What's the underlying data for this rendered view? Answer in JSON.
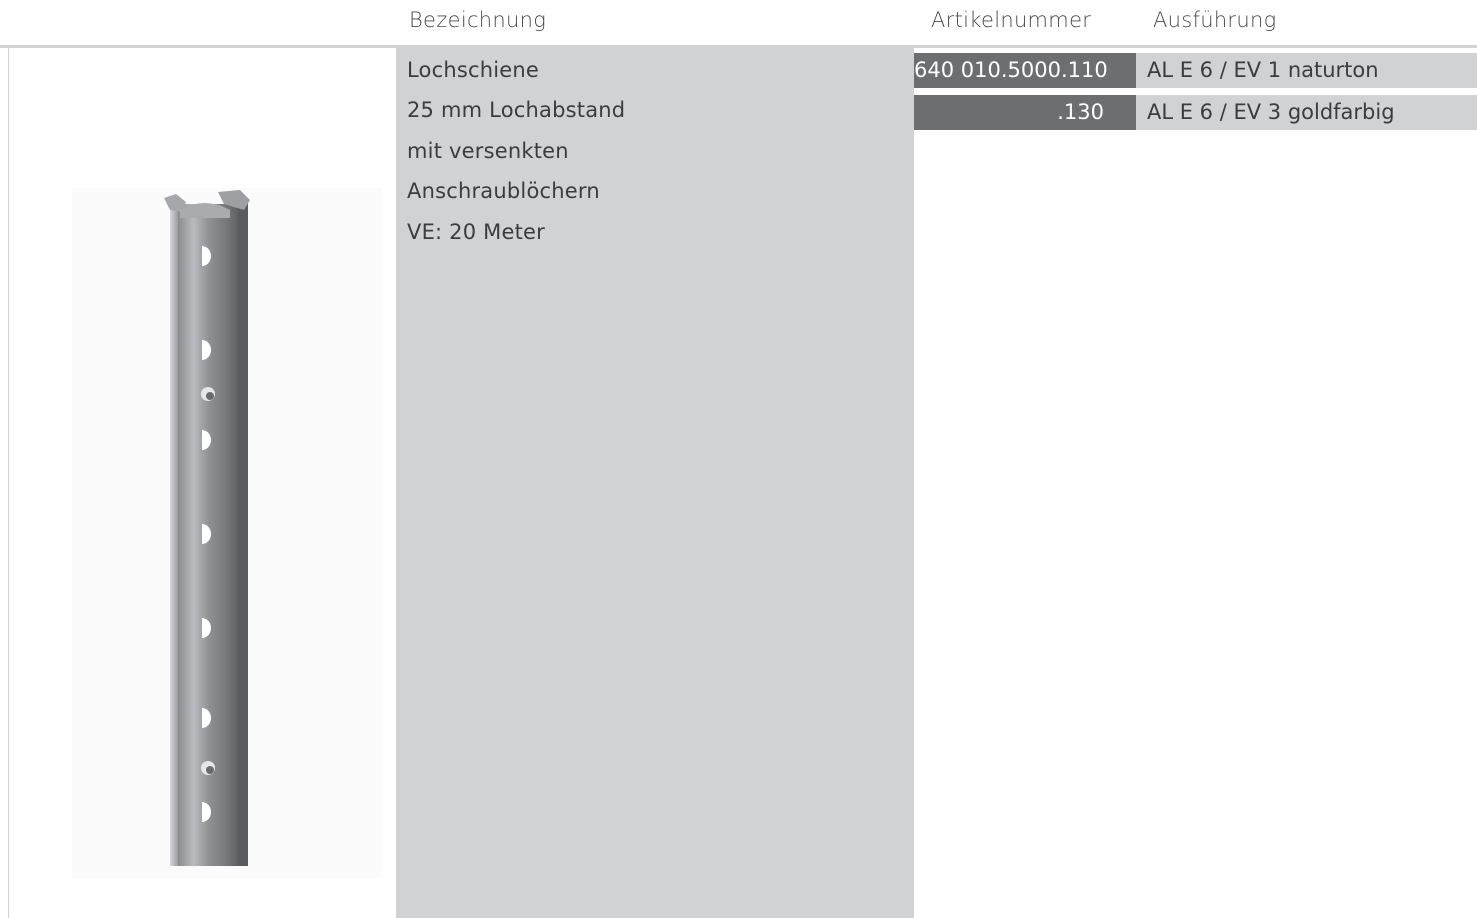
{
  "header": {
    "bezeichnung": "Bezeichnung",
    "artikelnummer": "Artikelnummer",
    "ausfuehrung": "Ausführung"
  },
  "product": {
    "description_lines": [
      "Lochschiene",
      "25 mm Lochabstand",
      "mit versenkten",
      "Anschraublöchern",
      "VE: 20 Meter"
    ],
    "variants": [
      {
        "artikelnummer": "640 010.5000.110",
        "ausfuehrung": "AL E 6 / EV 1 naturton"
      },
      {
        "artikelnummer": ".130",
        "ausfuehrung": "AL E 6 / EV 3 goldfarbig"
      }
    ],
    "image_icon": "perforated-rail-icon"
  },
  "colors": {
    "panel_gray": "#d1d2d4",
    "artnr_dark": "#6d6e70",
    "text": "#3c3c3c"
  }
}
